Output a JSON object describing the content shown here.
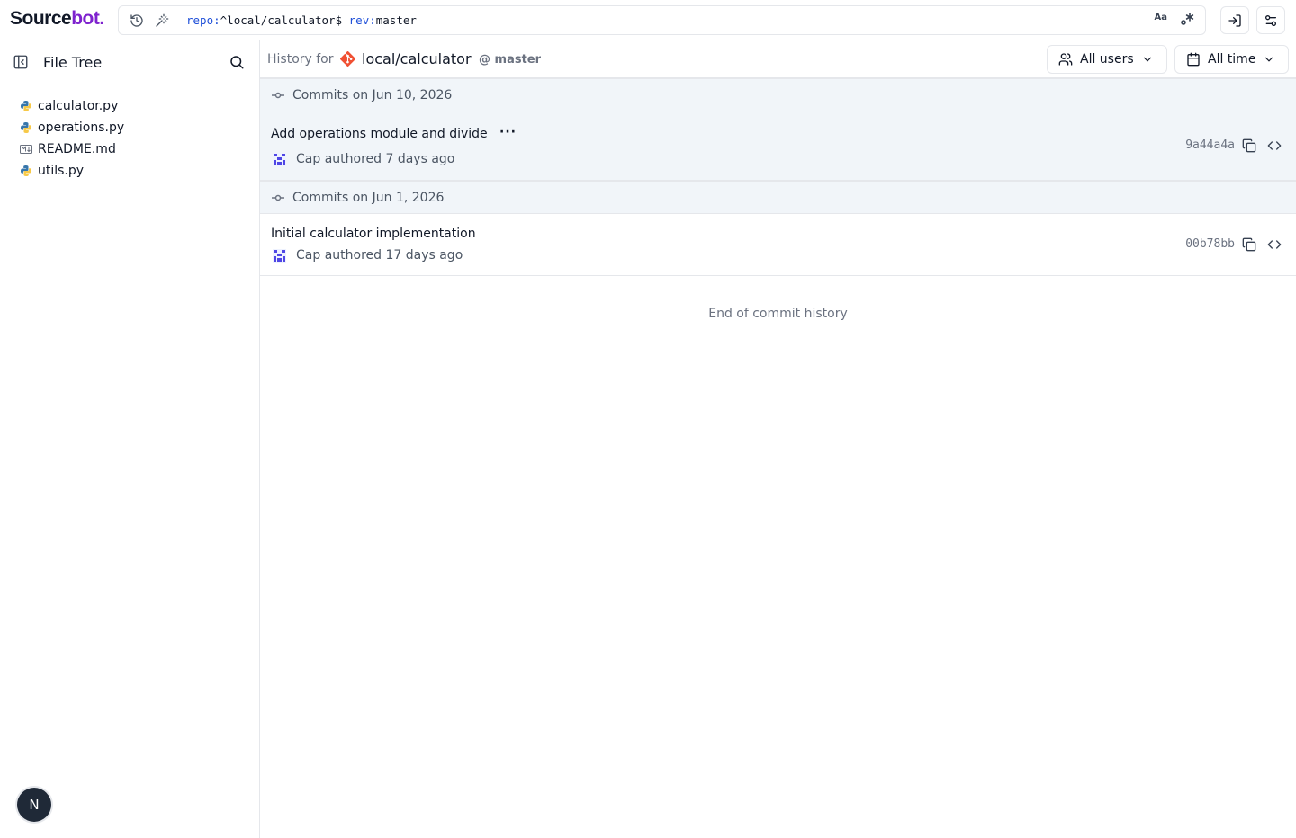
{
  "logo": {
    "part1": "Source",
    "part2": "bot."
  },
  "search": {
    "query_repo_key": "repo:",
    "query_repo_value": "^local/calculator$",
    "query_rev_key": "rev:",
    "query_rev_value": "master",
    "case_toggle": "Aa"
  },
  "sidebar": {
    "title": "File Tree",
    "files": [
      {
        "name": "calculator.py",
        "icon": "python-icon"
      },
      {
        "name": "operations.py",
        "icon": "python-icon"
      },
      {
        "name": "README.md",
        "icon": "markdown-icon"
      },
      {
        "name": "utils.py",
        "icon": "python-icon"
      }
    ],
    "avatar_letter": "N"
  },
  "history": {
    "label": "History for",
    "repo": "local/calculator",
    "branch": "@ master",
    "users_filter": "All users",
    "time_filter": "All time",
    "groups": [
      {
        "label": "Commits on Jun 10, 2026",
        "commits": [
          {
            "message": "Add operations module and divide",
            "more": "···",
            "author_line": "Cap authored 7 days ago",
            "sha": "9a44a4a"
          }
        ]
      },
      {
        "label": "Commits on Jun 1, 2026",
        "commits": [
          {
            "message": "Initial calculator implementation",
            "author_line": "Cap authored 17 days ago",
            "sha": "00b78bb"
          }
        ]
      }
    ],
    "end_text": "End of commit history"
  },
  "colors": {
    "brand_purple": "#7e22ce",
    "git_orange": "#f05033",
    "group_bg": "#f1f5f9"
  }
}
